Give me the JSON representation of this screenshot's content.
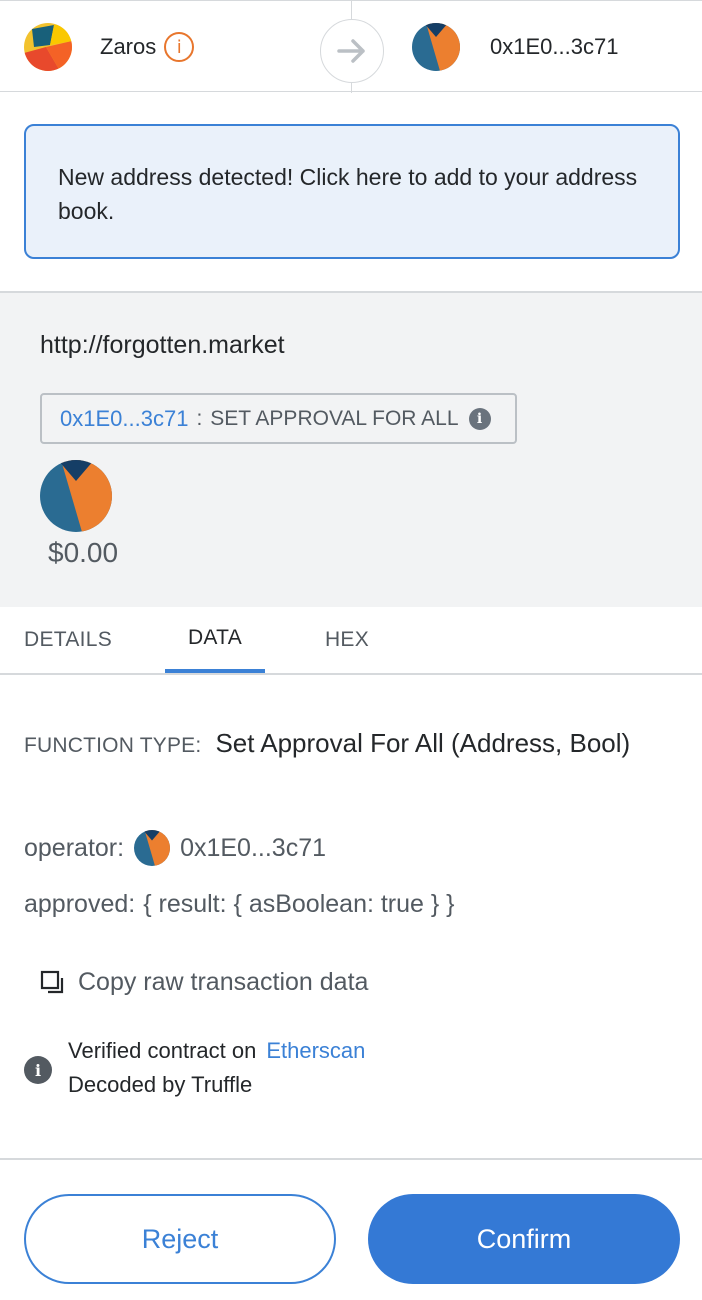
{
  "header": {
    "sender_name": "Zaros",
    "sender_info_icon": "info-icon",
    "arrow_icon": "arrow-right-icon",
    "recipient_address": "0x1E0...3c71"
  },
  "alert": {
    "text": "New address detected! Click here to add to your address book."
  },
  "summary": {
    "origin": "http://forgotten.market",
    "method_address": "0x1E0...3c71",
    "method_separator": ":",
    "method_name": "SET APPROVAL FOR ALL",
    "method_info_icon": "info-icon",
    "amount": "$0.00"
  },
  "tabs": [
    {
      "label": "DETAILS",
      "active": false
    },
    {
      "label": "DATA",
      "active": true
    },
    {
      "label": "HEX",
      "active": false
    }
  ],
  "data_tab": {
    "function_type_label": "FUNCTION TYPE:",
    "function_type_value": "Set Approval For All (Address, Bool)",
    "operator_label": "operator:",
    "operator_value": "0x1E0...3c71",
    "approved_label": "approved:",
    "approved_value": "{ result: { asBoolean: true } }",
    "copy_label": "Copy raw transaction data",
    "verified_text": "Verified contract on",
    "verified_link": "Etherscan",
    "decoded_text": "Decoded by Truffle"
  },
  "footer": {
    "reject_label": "Reject",
    "confirm_label": "Confirm"
  },
  "colors": {
    "accent": "#3b81d6",
    "warning": "#e8762d",
    "alert_bg": "#eaf1fa",
    "summary_bg": "#f2f3f4"
  }
}
